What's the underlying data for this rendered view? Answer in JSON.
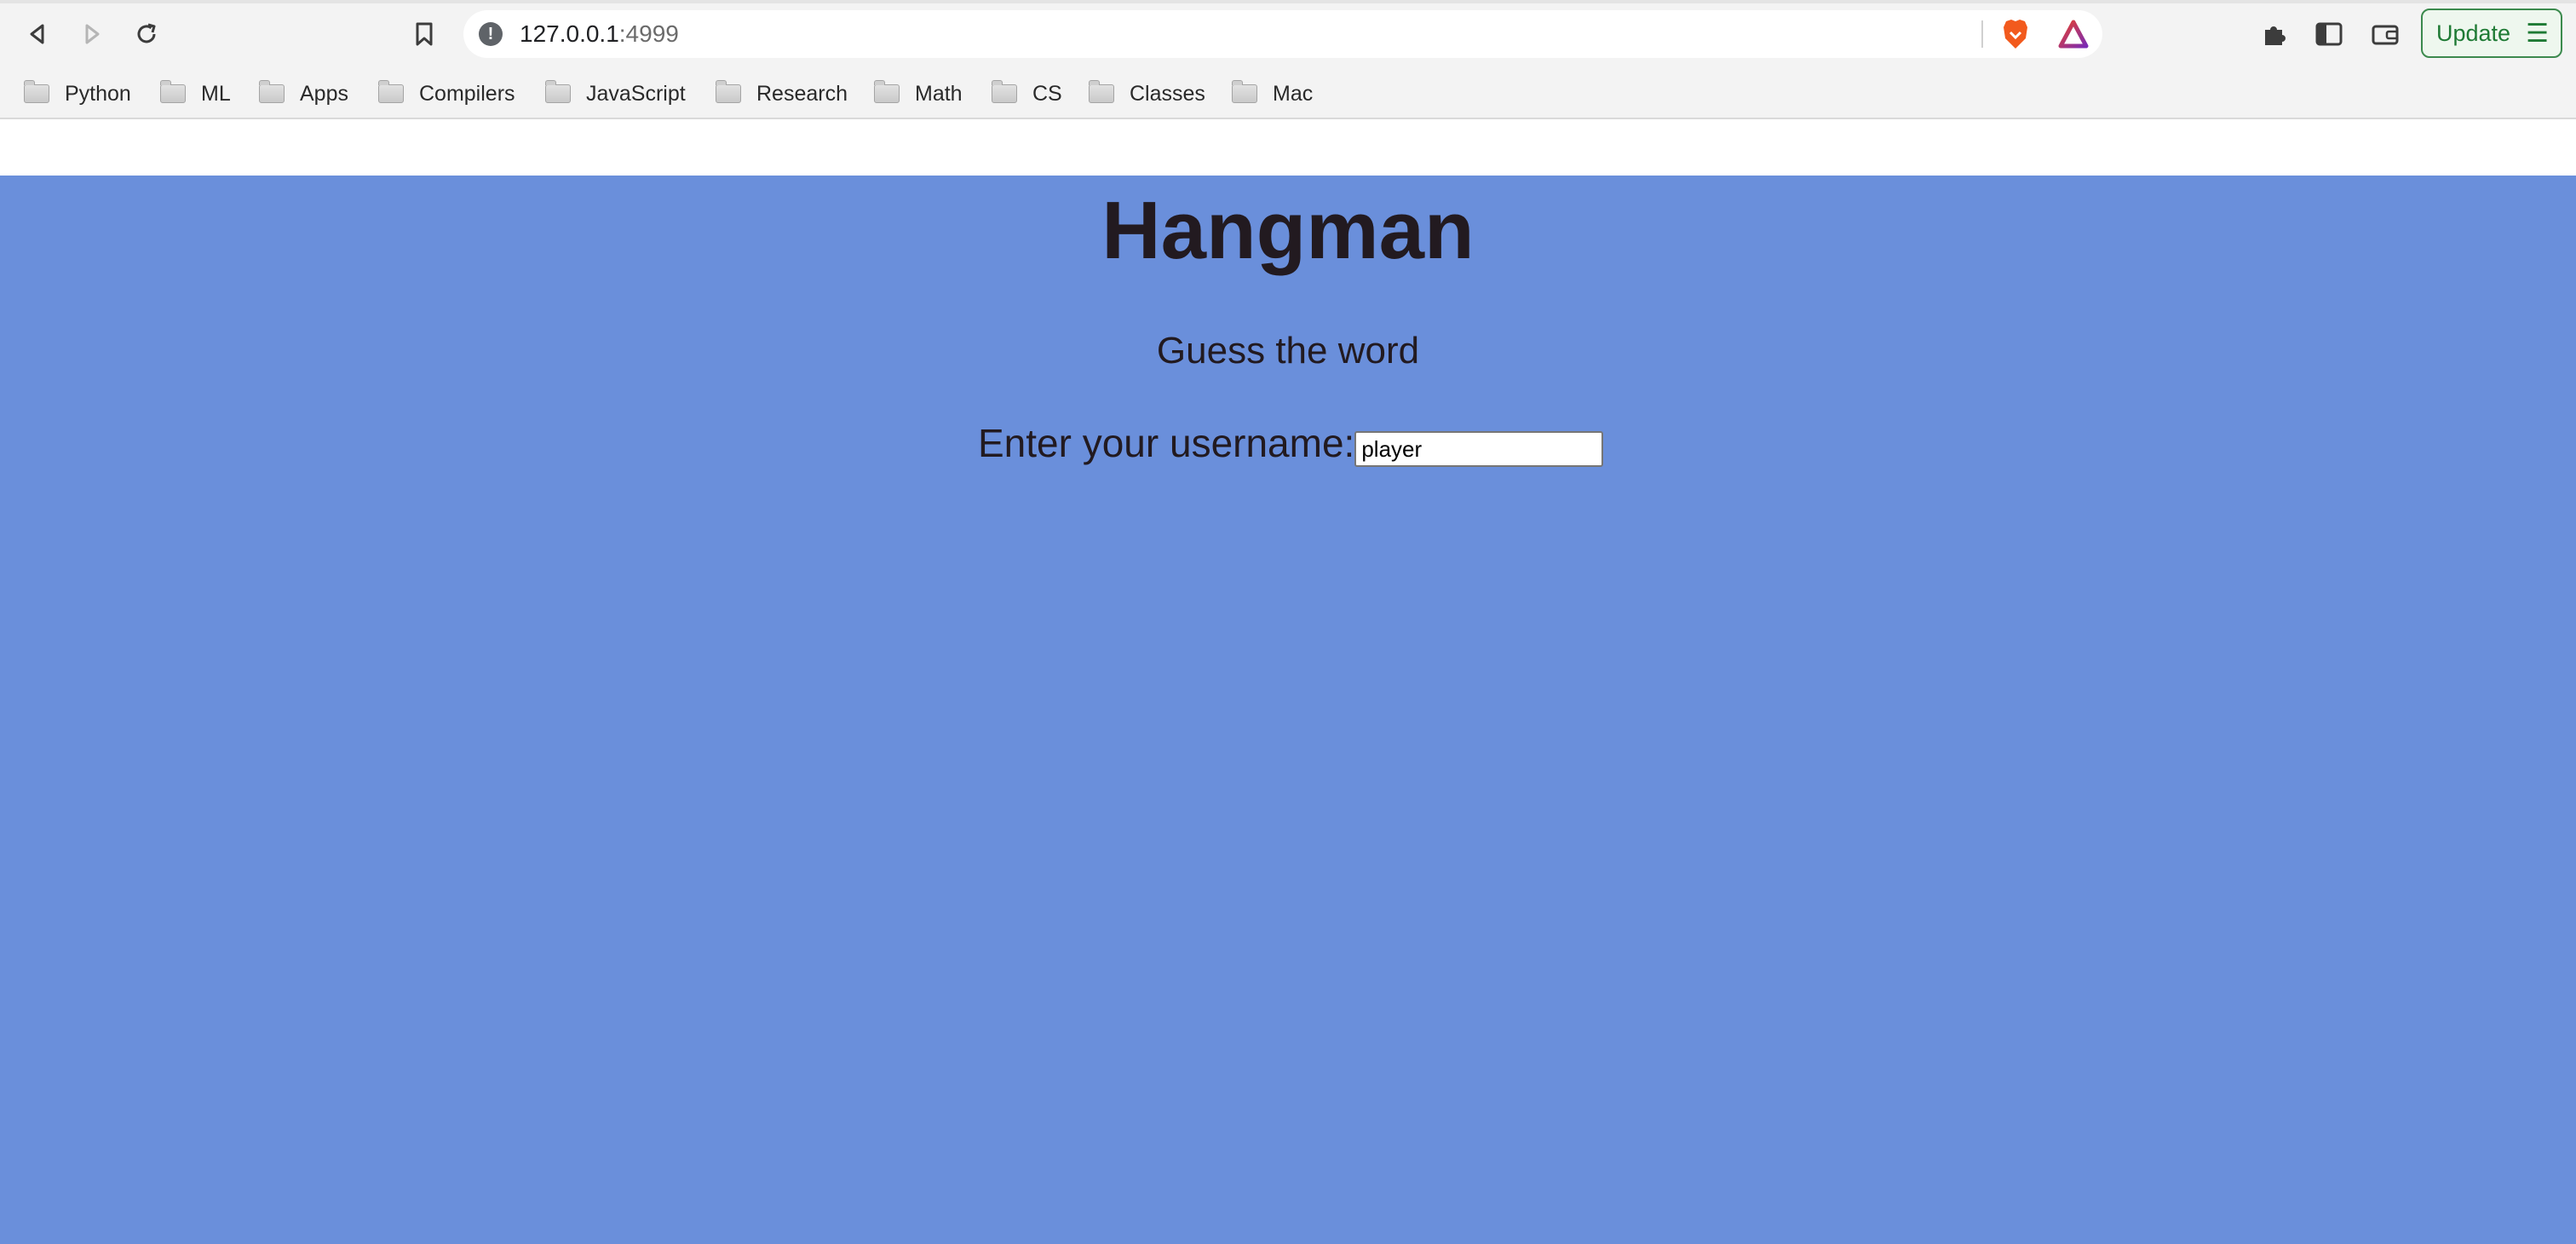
{
  "browser": {
    "url_host": "127.0.0.1",
    "url_port": ":4999",
    "update_label": "Update",
    "icons": {
      "back": "back-arrow-icon",
      "forward": "forward-arrow-icon",
      "reload": "reload-icon",
      "bookmark": "bookmark-icon",
      "site_info": "info-icon",
      "brave_shields": "brave-lion-icon",
      "brave_rewards": "rewards-triangle-icon",
      "extensions": "puzzle-icon",
      "sidebar": "sidebar-icon",
      "wallet": "wallet-icon",
      "menu": "hamburger-menu-icon"
    }
  },
  "bookmarks": [
    {
      "label": "Python"
    },
    {
      "label": "ML"
    },
    {
      "label": "Apps"
    },
    {
      "label": "Compilers"
    },
    {
      "label": "JavaScript"
    },
    {
      "label": "Research"
    },
    {
      "label": "Math"
    },
    {
      "label": "CS"
    },
    {
      "label": "Classes"
    },
    {
      "label": "Mac"
    }
  ],
  "page": {
    "title": "Hangman",
    "subtitle": "Guess the word",
    "username_label": "Enter your username:",
    "username_value": "player",
    "background_color": "#6a8fdb",
    "text_color": "#221a20"
  }
}
